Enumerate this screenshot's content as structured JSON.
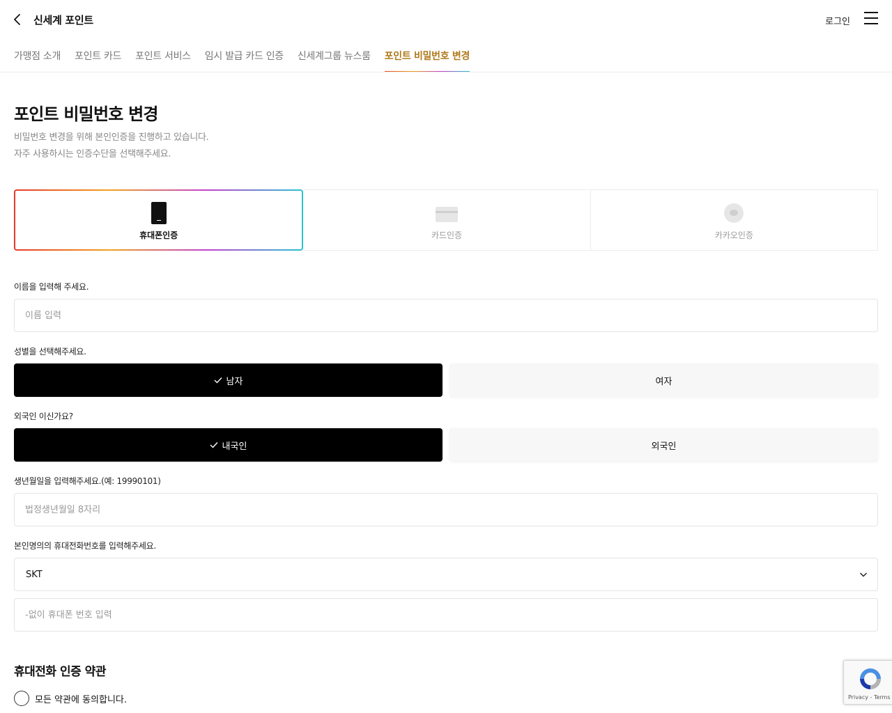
{
  "header": {
    "title": "신세계 포인트",
    "login_label": "로그인"
  },
  "tabs": [
    {
      "label": "가맹점 소개",
      "active": false
    },
    {
      "label": "포인트 카드",
      "active": false
    },
    {
      "label": "포인트 서비스",
      "active": false
    },
    {
      "label": "임시 발급 카드 인증",
      "active": false
    },
    {
      "label": "신세계그룹 뉴스룸",
      "active": false
    },
    {
      "label": "포인트 비밀번호 변경",
      "active": true
    }
  ],
  "page": {
    "title": "포인트 비밀번호 변경",
    "desc_line1": "비밀번호 변경을 위해 본인인증을 진행하고 있습니다.",
    "desc_line2": "자주 사용하시는 인증수단을 선택해주세요."
  },
  "auth_methods": [
    {
      "label": "휴대폰인증",
      "icon": "phone-icon",
      "selected": true
    },
    {
      "label": "카드인증",
      "icon": "card-icon",
      "selected": false
    },
    {
      "label": "카카오인증",
      "icon": "kakao-icon",
      "selected": false
    }
  ],
  "form": {
    "name_label": "이름을 입력해 주세요.",
    "name_placeholder": "이름 입력",
    "gender_label": "성별을 선택해주세요.",
    "gender_male": "남자",
    "gender_female": "여자",
    "gender_selected": "남자",
    "foreigner_label": "외국인 이신가요?",
    "domestic": "내국인",
    "foreign": "외국인",
    "foreigner_selected": "내국인",
    "birth_label": "생년월일을 입력해주세요.(예: 19990101)",
    "birth_placeholder": "법정생년월일 8자리",
    "phone_label": "본인명의의 휴대전화번호를 입력해주세요.",
    "carrier_value": "SKT",
    "phone_placeholder": "-없이 휴대폰 번호 입력"
  },
  "terms": {
    "title": "휴대전화 인증 약관",
    "agree_all": "모든 약관에 동의합니다."
  },
  "recaptcha": {
    "links": "Privacy - Terms"
  },
  "colors": {
    "active_tab": "#b07a1c",
    "gradient": [
      "#e8382b",
      "#f2a21d",
      "#c241d0",
      "#27c4d0"
    ],
    "selected_button": "#000000"
  }
}
